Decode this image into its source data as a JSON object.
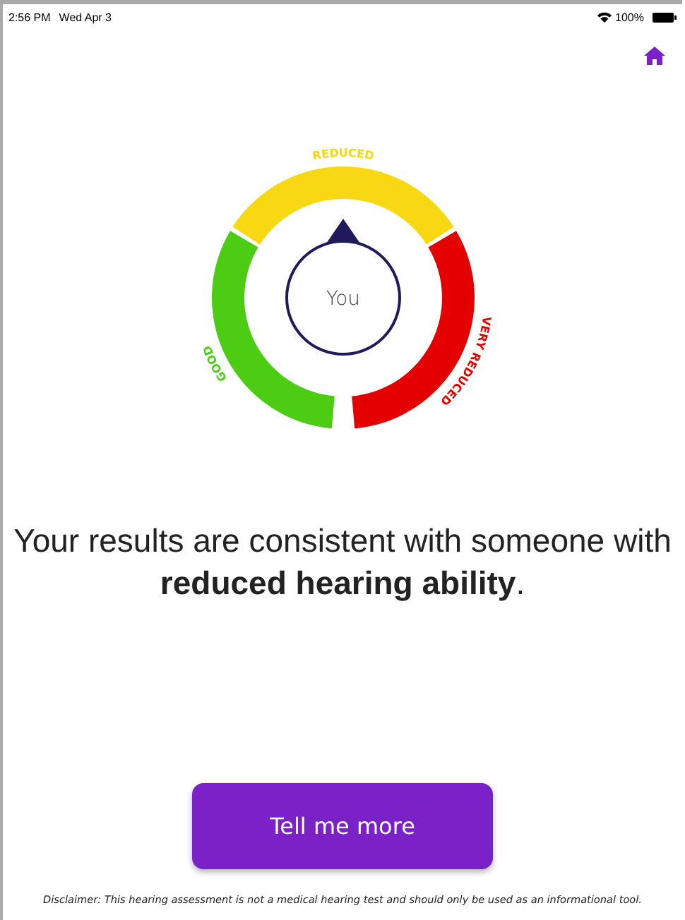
{
  "status_bar": {
    "time": "2:56 PM",
    "date": "Wed Apr 3",
    "battery_text": "100%"
  },
  "gauge": {
    "center_label": "You",
    "segments": [
      {
        "label": "GOOD",
        "color": "#4ccd14",
        "selected": false
      },
      {
        "label": "REDUCED",
        "color": "#f7d812",
        "selected": true
      },
      {
        "label": "VERY REDUCED",
        "color": "#e50000",
        "selected": false
      }
    ]
  },
  "result": "Your results are consistent with someone with **reduced hearing ability**.",
  "button": "Tell me more",
  "disclaimer": "Disclaimer: This hearing assessment is not a medical hearing test and should only be used as an informational tool."
}
